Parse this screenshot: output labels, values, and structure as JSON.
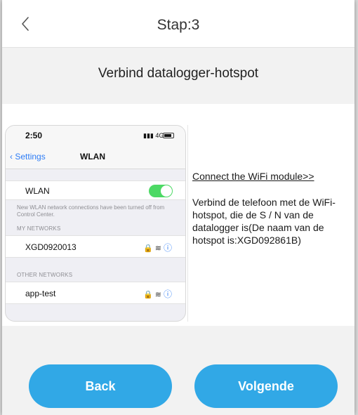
{
  "header": {
    "title": "Stap:3",
    "back_icon": "chevron-left-icon"
  },
  "subtitle": "Verbind datalogger-hotspot",
  "phone": {
    "time": "2:50",
    "signal": "4G",
    "back_label": "Settings",
    "nav_title": "WLAN",
    "wlan_label": "WLAN",
    "wlan_enabled": true,
    "note": "New WLAN network connections have been turned off from Control Center.",
    "my_networks_header": "MY NETWORKS",
    "my_networks": [
      "XGD0920013"
    ],
    "other_networks_header": "OTHER NETWORKS",
    "other_networks": [
      "app-test"
    ],
    "toggle_color": "#4cd964",
    "link_color": "#2d7cf6"
  },
  "connect_link": "Connect the WiFi module>>",
  "description": "Verbind de telefoon met de WiFi-hotspot, die de S / N van de datalogger is(De naam van de hotspot is:XGD092861B)",
  "buttons": {
    "back_label": "Back",
    "next_label": "Volgende",
    "color": "#31a8e6"
  }
}
